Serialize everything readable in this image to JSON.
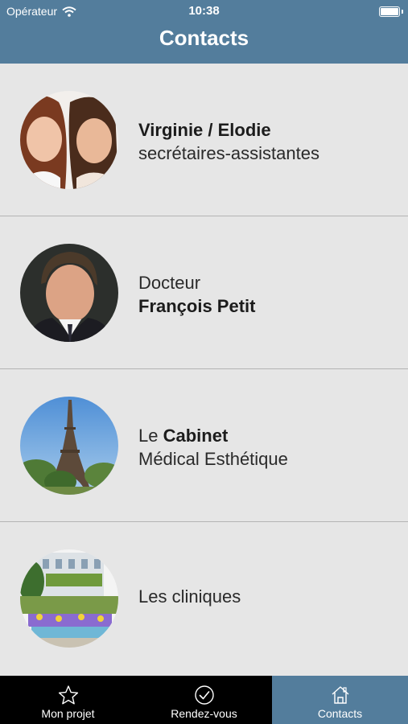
{
  "status_bar": {
    "carrier": "Opérateur",
    "time": "10:38"
  },
  "header": {
    "title": "Contacts"
  },
  "contacts": [
    {
      "line1_bold": "Virginie / Elodie",
      "line2": "secrétaires-assistantes",
      "avatar": "two-women-photo"
    },
    {
      "line1": "Docteur",
      "line2_bold": "François Petit",
      "avatar": "doctor-portrait-photo"
    },
    {
      "line1_prefix": "Le ",
      "line1_bold": "Cabinet",
      "line2": "Médical Esthétique",
      "avatar": "eiffel-tower-photo"
    },
    {
      "line1": "Les cliniques",
      "avatar": "clinic-garden-photo"
    }
  ],
  "tabbar": {
    "items": [
      {
        "label": "Mon projet",
        "icon": "star-icon"
      },
      {
        "label": "Rendez-vous",
        "icon": "check-circle-icon"
      },
      {
        "label": "Contacts",
        "icon": "home-icon",
        "active": true
      }
    ]
  },
  "colors": {
    "accent": "#537d9c",
    "background": "#e6e6e6",
    "tabbar": "#000000"
  }
}
